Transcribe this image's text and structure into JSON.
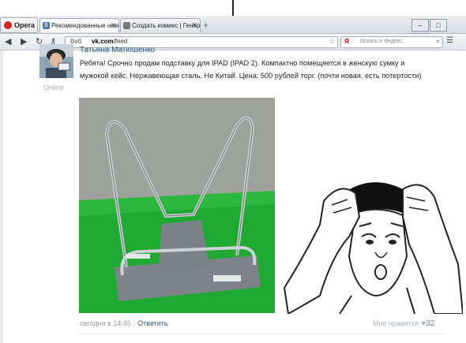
{
  "browser": {
    "menu_label": "Opera",
    "tabs": [
      {
        "label": "Рекомендованные ново...",
        "active": true
      },
      {
        "label": "Создать комикс | Генер...",
        "active": false
      }
    ],
    "address": {
      "web_label": "Веб",
      "url_host": "vk.com",
      "url_path": "/feed"
    },
    "search_placeholder": "Искать в Яндекс",
    "search_logo": "Я"
  },
  "post": {
    "author": "Татьяна Матюшенко",
    "status": "Online",
    "text": "Ребята! Срочно продам подставку для IPAD (IPAD 2). Компактно помещяется в женскую сумку и мужокой кейс. Нержавеющая сталь. Не Китай. Цена: 500 рублей торг. (почти новая, есть потертости)",
    "date": "сегодня в 14:45",
    "separator": "|",
    "reply_label": "Ответить",
    "likes_label": "Мне нравится",
    "likes_count": "32"
  },
  "colors": {
    "link": "#2b587a",
    "vk_blue": "#4a76a8",
    "photo_green": "#1fa832"
  },
  "icons": [
    "back-icon",
    "forward-icon",
    "reload-icon",
    "key-icon",
    "web-icon",
    "star-icon",
    "search-icon",
    "heart-icon",
    "close-icon",
    "add-tab-icon"
  ]
}
